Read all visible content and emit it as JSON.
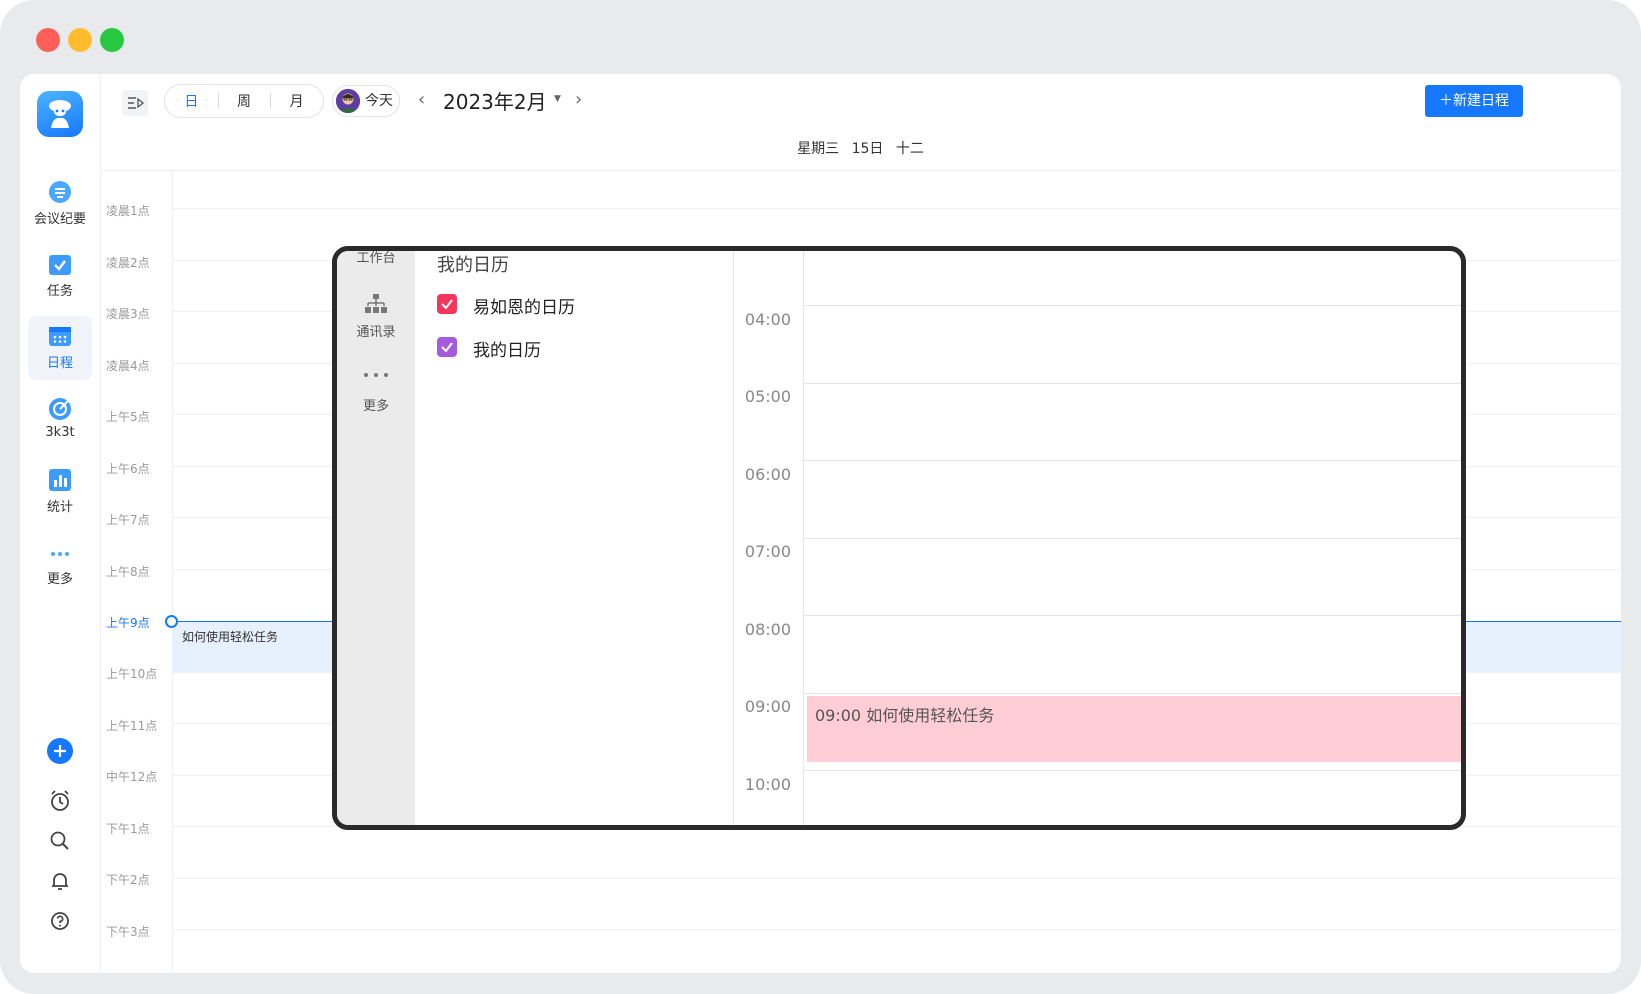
{
  "window": {
    "traffic_colors": [
      "#fe5f57",
      "#febc2e",
      "#28c840"
    ]
  },
  "nav": {
    "items": [
      {
        "label": "会议纪要",
        "icon": "meeting-notes-icon"
      },
      {
        "label": "任务",
        "icon": "task-icon"
      },
      {
        "label": "日程",
        "icon": "calendar-icon",
        "active": true
      },
      {
        "label": "3k3t",
        "icon": "target-icon"
      },
      {
        "label": "统计",
        "icon": "stats-icon"
      },
      {
        "label": "更多",
        "icon": "more-icon"
      }
    ],
    "bottom_icons": [
      "add-icon",
      "alarm-icon",
      "search-icon",
      "bell-icon",
      "help-icon"
    ]
  },
  "toolbar": {
    "views": [
      "日",
      "周",
      "月"
    ],
    "selected_view": "日",
    "today_label": "今天",
    "month_label": "2023年2月",
    "new_event_label": "新建日程",
    "accent": "#1677ff"
  },
  "day_header": {
    "weekday": "星期三",
    "date": "15日",
    "lunar": "十二"
  },
  "time_labels": [
    "凌晨1点",
    "凌晨2点",
    "凌晨3点",
    "凌晨4点",
    "上午5点",
    "上午6点",
    "上午7点",
    "上午8点",
    "上午9点",
    "上午10点",
    "上午11点",
    "中午12点",
    "下午1点",
    "下午2点",
    "下午3点"
  ],
  "current_time_label": "上午9点",
  "event": {
    "title": "如何使用轻松任务",
    "color": "#e6f1fd"
  },
  "zoom": {
    "side_items": [
      "工作台",
      "通讯录",
      "更多"
    ],
    "calendar_section_title": "我的日历",
    "calendars": [
      {
        "label": "易如恩的日历",
        "color": "#f5365c"
      },
      {
        "label": "我的日历",
        "color": "#a55bdb"
      }
    ],
    "times": [
      "04:00",
      "05:00",
      "06:00",
      "07:00",
      "08:00",
      "09:00",
      "10:00"
    ],
    "event_text": "09:00 如何使用轻松任务",
    "event_color": "#ffcdd6"
  }
}
